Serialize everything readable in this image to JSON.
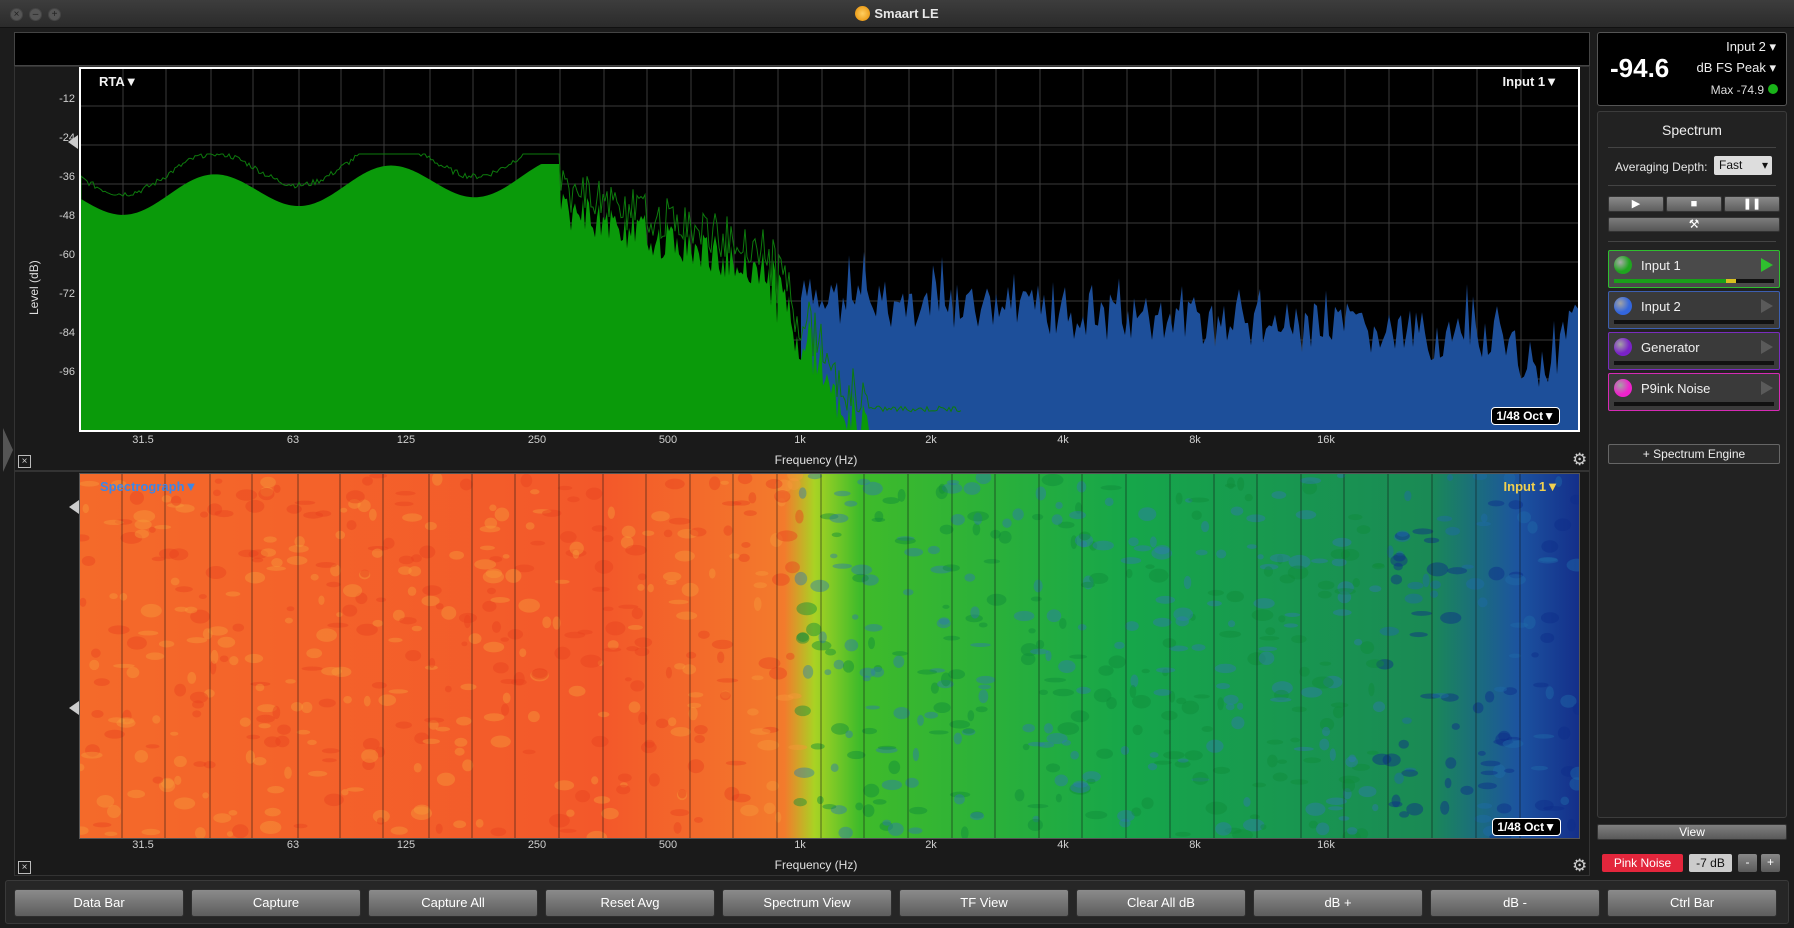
{
  "window": {
    "title": "Smaart LE"
  },
  "rta": {
    "mode_label": "RTA▼",
    "input_label": "Input 1▼",
    "resolution": "1/48 Oct",
    "y_axis_label": "Level (dB)",
    "x_axis_label": "Frequency (Hz)",
    "y_ticks": [
      "-12",
      "-24",
      "-36",
      "-48",
      "-60",
      "-72",
      "-84",
      "-96"
    ],
    "x_ticks": [
      "31.5",
      "63",
      "125",
      "250",
      "500",
      "1k",
      "2k",
      "4k",
      "8k",
      "16k"
    ]
  },
  "spectrograph": {
    "mode_label": "Spectrograph▼",
    "input_label": "Input 1▼",
    "resolution": "1/48 Oct",
    "x_axis_label": "Frequency (Hz)",
    "x_ticks": [
      "31.5",
      "63",
      "125",
      "250",
      "500",
      "1k",
      "2k",
      "4k",
      "8k",
      "16k"
    ]
  },
  "meter": {
    "value": "-94.6",
    "input_select": "Input 2",
    "unit_select": "dB FS Peak",
    "max_label": "Max -74.9"
  },
  "spectrum_panel": {
    "title": "Spectrum",
    "averaging_label": "Averaging Depth:",
    "averaging_value": "Fast",
    "engines": [
      {
        "name": "Input 1",
        "color": "#1fa51f",
        "border": "#2fbf2f"
      },
      {
        "name": "Input 2",
        "color": "#3366dd",
        "border": "#3d5fb0"
      },
      {
        "name": "Generator",
        "color": "#7a22c9",
        "border": "#7a2cbf"
      },
      {
        "name": "P9ink Noise",
        "color": "#ee22cc",
        "border": "#d62ab5"
      }
    ],
    "add_engine_label": "+ Spectrum Engine"
  },
  "view_label": "View",
  "generator": {
    "label": "Pink Noise",
    "gain": "-7 dB",
    "minus": "-",
    "plus": "+"
  },
  "bottom_bar": [
    "Data Bar",
    "Capture",
    "Capture All",
    "Reset Avg",
    "Spectrum View",
    "TF View",
    "Clear All dB",
    "dB +",
    "dB -",
    "Ctrl Bar"
  ],
  "colors": {
    "rta_green": "#0a9a0a",
    "rta_blue": "#1d4f9a",
    "pink_noise": "#e3263c"
  }
}
